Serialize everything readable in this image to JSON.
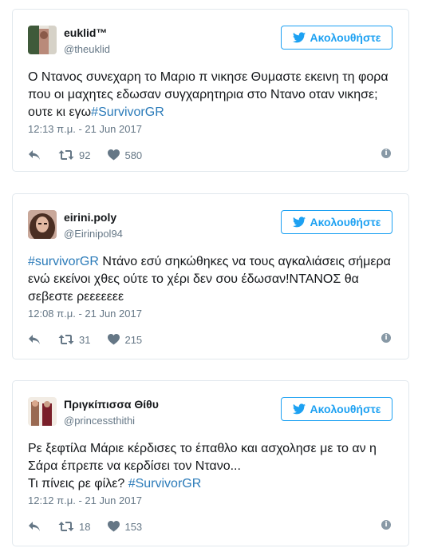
{
  "tweets": [
    {
      "display_name": "euklid™",
      "handle": "@theuklid",
      "follow_label": "Ακολουθήστε",
      "text_parts": [
        {
          "t": "Ο Ντανος συνεχαρη το Μαριο π νικησε Θυμαστε εκεινη τη φορα που οι μαχητες εδωσαν συγχαρητηρια στο Ντανο οταν νικησε; ουτε κι εγω",
          "tag": false
        },
        {
          "t": "#SurvivorGR",
          "tag": true
        }
      ],
      "timestamp": "12:13 π.μ. - 21 Jun 2017",
      "retweets": "92",
      "likes": "580"
    },
    {
      "display_name": "eirini.poly",
      "handle": "@Eirinipol94",
      "follow_label": "Ακολουθήστε",
      "text_parts": [
        {
          "t": "#survivorGR",
          "tag": true
        },
        {
          "t": " Ντάνο εσύ σηκώθηκες να τους αγκαλιάσεις σήμερα ενώ εκείνοι χθες ούτε το χέρι δεν σου έδωσαν!ΝΤΑΝΟΣ θα σεβεστε ρεεεεεεε",
          "tag": false
        }
      ],
      "timestamp": "12:08 π.μ. - 21 Jun 2017",
      "retweets": "31",
      "likes": "215"
    },
    {
      "display_name": "Πριγκίπισσα Θίθυ",
      "handle": "@princessthithi",
      "follow_label": "Ακολουθήστε",
      "text_parts": [
        {
          "t": "Ρε ξεφτίλα Μάριε κέρδισες το έπαθλο και ασχολησε με το αν η Σάρα έπρεπε να κερδίσει τον Ντανο...\nΤι πίνεις ρε φίλε? ",
          "tag": false
        },
        {
          "t": "#SurvivorGR",
          "tag": true
        }
      ],
      "timestamp": "12:12 π.μ. - 21 Jun 2017",
      "retweets": "18",
      "likes": "153"
    }
  ],
  "colors": {
    "accent": "#1da1f2",
    "hashtag": "#2b7bb9",
    "muted": "#657786",
    "border": "#e1e8ed"
  },
  "icons": [
    "twitter-bird-icon",
    "reply-icon",
    "retweet-icon",
    "heart-icon",
    "info-icon"
  ]
}
